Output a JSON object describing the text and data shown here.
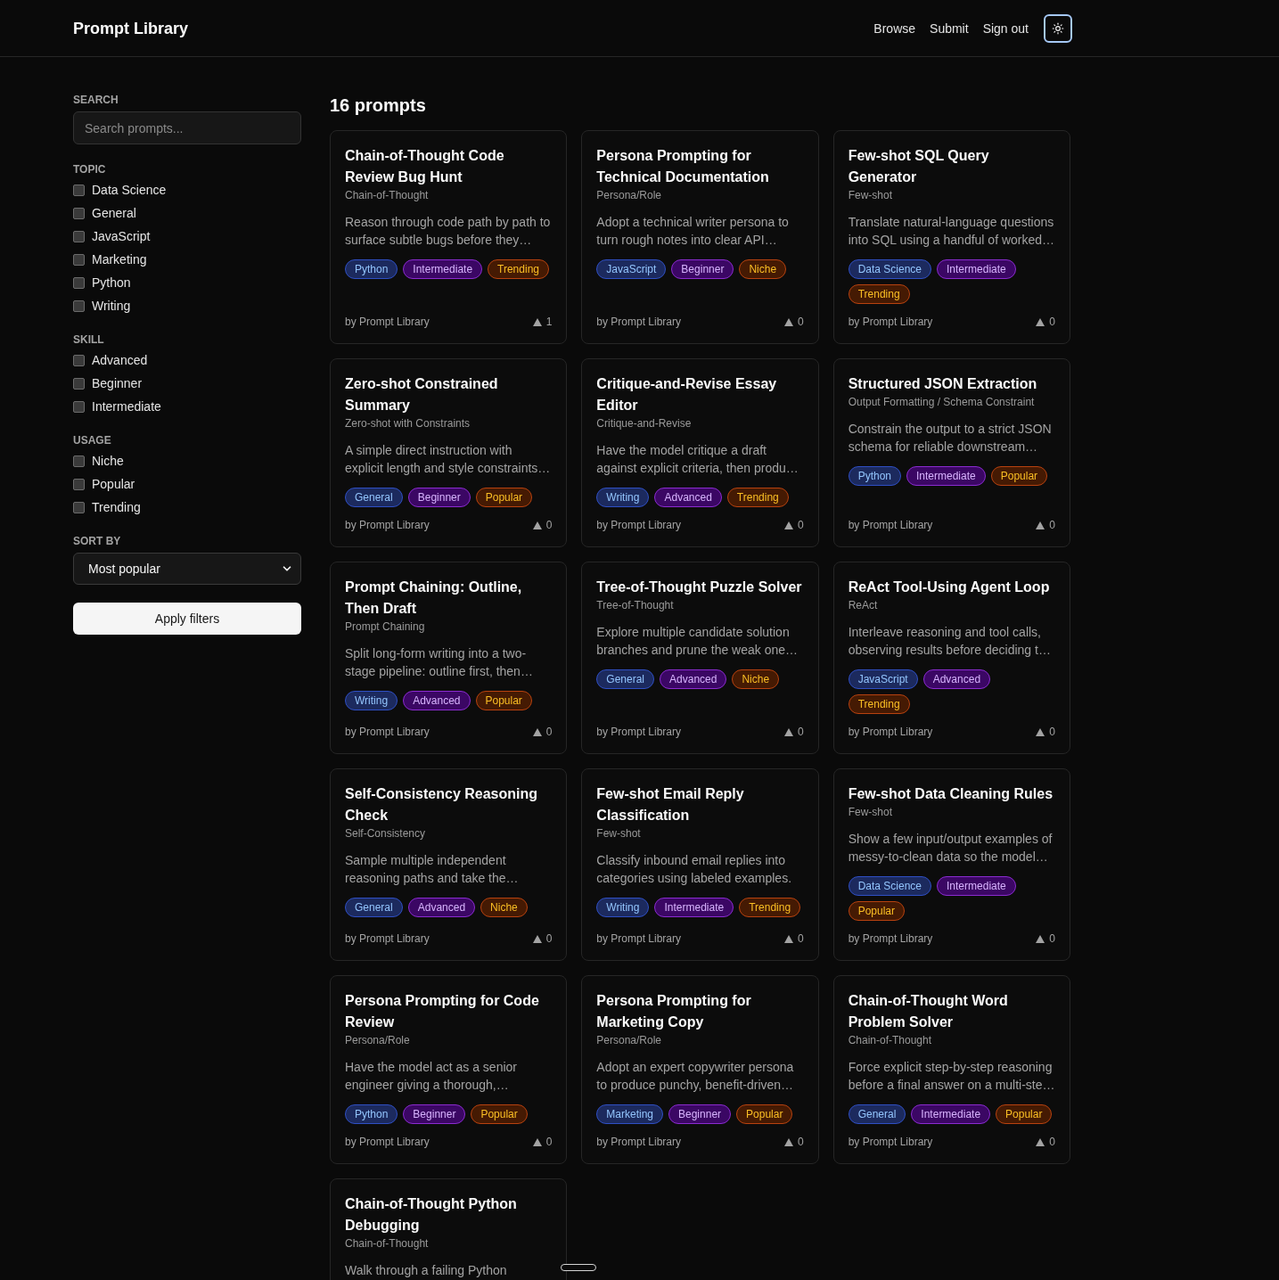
{
  "header": {
    "title": "Prompt Library",
    "nav": [
      "Browse",
      "Submit",
      "Sign out"
    ]
  },
  "sidebar": {
    "search": {
      "label": "SEARCH",
      "placeholder": "Search prompts..."
    },
    "filter_groups": [
      {
        "label": "TOPIC",
        "options": [
          {
            "label": "Data Science",
            "checked": false
          },
          {
            "label": "General",
            "checked": false
          },
          {
            "label": "JavaScript",
            "checked": false
          },
          {
            "label": "Marketing",
            "checked": false
          },
          {
            "label": "Python",
            "checked": false
          },
          {
            "label": "Writing",
            "checked": false
          }
        ]
      },
      {
        "label": "SKILL",
        "options": [
          {
            "label": "Advanced",
            "checked": false
          },
          {
            "label": "Beginner",
            "checked": false
          },
          {
            "label": "Intermediate",
            "checked": false
          }
        ]
      },
      {
        "label": "USAGE",
        "options": [
          {
            "label": "Niche",
            "checked": false
          },
          {
            "label": "Popular",
            "checked": false
          },
          {
            "label": "Trending",
            "checked": false
          }
        ]
      }
    ],
    "sort": {
      "label": "SORT BY",
      "value": "Most popular"
    },
    "apply_button": "Apply filters"
  },
  "results": {
    "count": "16 prompts",
    "cards": [
      {
        "title": "Chain-of-Thought Code Review Bug Hunt",
        "technique": "Chain-of-Thought",
        "description": "Reason through code path by path to surface subtle bugs before they…",
        "tags": [
          {
            "label": "Python",
            "kind": "topic"
          },
          {
            "label": "Intermediate",
            "kind": "skill"
          },
          {
            "label": "Trending",
            "kind": "usage"
          }
        ],
        "author": "by Prompt Library",
        "votes": "1"
      },
      {
        "title": "Persona Prompting for Technical Documentation",
        "technique": "Persona/Role",
        "description": "Adopt a technical writer persona to turn rough notes into clear API…",
        "tags": [
          {
            "label": "JavaScript",
            "kind": "topic"
          },
          {
            "label": "Beginner",
            "kind": "skill"
          },
          {
            "label": "Niche",
            "kind": "usage"
          }
        ],
        "author": "by Prompt Library",
        "votes": "0"
      },
      {
        "title": "Few-shot SQL Query Generator",
        "technique": "Few-shot",
        "description": "Translate natural-language questions into SQL using a handful of worked…",
        "tags": [
          {
            "label": "Data Science",
            "kind": "topic"
          },
          {
            "label": "Intermediate",
            "kind": "skill"
          },
          {
            "label": "Trending",
            "kind": "usage"
          }
        ],
        "author": "by Prompt Library",
        "votes": "0"
      },
      {
        "title": "Zero-shot Constrained Summary",
        "technique": "Zero-shot with Constraints",
        "description": "A simple direct instruction with explicit length and style constraints…",
        "tags": [
          {
            "label": "General",
            "kind": "topic"
          },
          {
            "label": "Beginner",
            "kind": "skill"
          },
          {
            "label": "Popular",
            "kind": "usage"
          }
        ],
        "author": "by Prompt Library",
        "votes": "0"
      },
      {
        "title": "Critique-and-Revise Essay Editor",
        "technique": "Critique-and-Revise",
        "description": "Have the model critique a draft against explicit criteria, then produ…",
        "tags": [
          {
            "label": "Writing",
            "kind": "topic"
          },
          {
            "label": "Advanced",
            "kind": "skill"
          },
          {
            "label": "Trending",
            "kind": "usage"
          }
        ],
        "author": "by Prompt Library",
        "votes": "0"
      },
      {
        "title": "Structured JSON Extraction",
        "technique": "Output Formatting / Schema Constraint",
        "description": "Constrain the output to a strict JSON schema for reliable downstream…",
        "tags": [
          {
            "label": "Python",
            "kind": "topic"
          },
          {
            "label": "Intermediate",
            "kind": "skill"
          },
          {
            "label": "Popular",
            "kind": "usage"
          }
        ],
        "author": "by Prompt Library",
        "votes": "0"
      },
      {
        "title": "Prompt Chaining: Outline, Then Draft",
        "technique": "Prompt Chaining",
        "description": "Split long-form writing into a two-stage pipeline: outline first, then…",
        "tags": [
          {
            "label": "Writing",
            "kind": "topic"
          },
          {
            "label": "Advanced",
            "kind": "skill"
          },
          {
            "label": "Popular",
            "kind": "usage"
          }
        ],
        "author": "by Prompt Library",
        "votes": "0"
      },
      {
        "title": "Tree-of-Thought Puzzle Solver",
        "technique": "Tree-of-Thought",
        "description": "Explore multiple candidate solution branches and prune the weak one…",
        "tags": [
          {
            "label": "General",
            "kind": "topic"
          },
          {
            "label": "Advanced",
            "kind": "skill"
          },
          {
            "label": "Niche",
            "kind": "usage"
          }
        ],
        "author": "by Prompt Library",
        "votes": "0"
      },
      {
        "title": "ReAct Tool-Using Agent Loop",
        "technique": "ReAct",
        "description": "Interleave reasoning and tool calls, observing results before deciding t…",
        "tags": [
          {
            "label": "JavaScript",
            "kind": "topic"
          },
          {
            "label": "Advanced",
            "kind": "skill"
          },
          {
            "label": "Trending",
            "kind": "usage"
          }
        ],
        "author": "by Prompt Library",
        "votes": "0"
      },
      {
        "title": "Self-Consistency Reasoning Check",
        "technique": "Self-Consistency",
        "description": "Sample multiple independent reasoning paths and take the…",
        "tags": [
          {
            "label": "General",
            "kind": "topic"
          },
          {
            "label": "Advanced",
            "kind": "skill"
          },
          {
            "label": "Niche",
            "kind": "usage"
          }
        ],
        "author": "by Prompt Library",
        "votes": "0"
      },
      {
        "title": "Few-shot Email Reply Classification",
        "technique": "Few-shot",
        "description": "Classify inbound email replies into categories using labeled examples.",
        "tags": [
          {
            "label": "Writing",
            "kind": "topic"
          },
          {
            "label": "Intermediate",
            "kind": "skill"
          },
          {
            "label": "Trending",
            "kind": "usage"
          }
        ],
        "author": "by Prompt Library",
        "votes": "0"
      },
      {
        "title": "Few-shot Data Cleaning Rules",
        "technique": "Few-shot",
        "description": "Show a few input/output examples of messy-to-clean data so the model…",
        "tags": [
          {
            "label": "Data Science",
            "kind": "topic"
          },
          {
            "label": "Intermediate",
            "kind": "skill"
          },
          {
            "label": "Popular",
            "kind": "usage"
          }
        ],
        "author": "by Prompt Library",
        "votes": "0"
      },
      {
        "title": "Persona Prompting for Code Review",
        "technique": "Persona/Role",
        "description": "Have the model act as a senior engineer giving a thorough,…",
        "tags": [
          {
            "label": "Python",
            "kind": "topic"
          },
          {
            "label": "Beginner",
            "kind": "skill"
          },
          {
            "label": "Popular",
            "kind": "usage"
          }
        ],
        "author": "by Prompt Library",
        "votes": "0"
      },
      {
        "title": "Persona Prompting for Marketing Copy",
        "technique": "Persona/Role",
        "description": "Adopt an expert copywriter persona to produce punchy, benefit-driven…",
        "tags": [
          {
            "label": "Marketing",
            "kind": "topic"
          },
          {
            "label": "Beginner",
            "kind": "skill"
          },
          {
            "label": "Popular",
            "kind": "usage"
          }
        ],
        "author": "by Prompt Library",
        "votes": "0"
      },
      {
        "title": "Chain-of-Thought Word Problem Solver",
        "technique": "Chain-of-Thought",
        "description": "Force explicit step-by-step reasoning before a final answer on a multi-ste…",
        "tags": [
          {
            "label": "General",
            "kind": "topic"
          },
          {
            "label": "Intermediate",
            "kind": "skill"
          },
          {
            "label": "Popular",
            "kind": "usage"
          }
        ],
        "author": "by Prompt Library",
        "votes": "0"
      },
      {
        "title": "Chain-of-Thought Python Debugging",
        "technique": "Chain-of-Thought",
        "description": "Walk through a failing Python"
      }
    ]
  }
}
